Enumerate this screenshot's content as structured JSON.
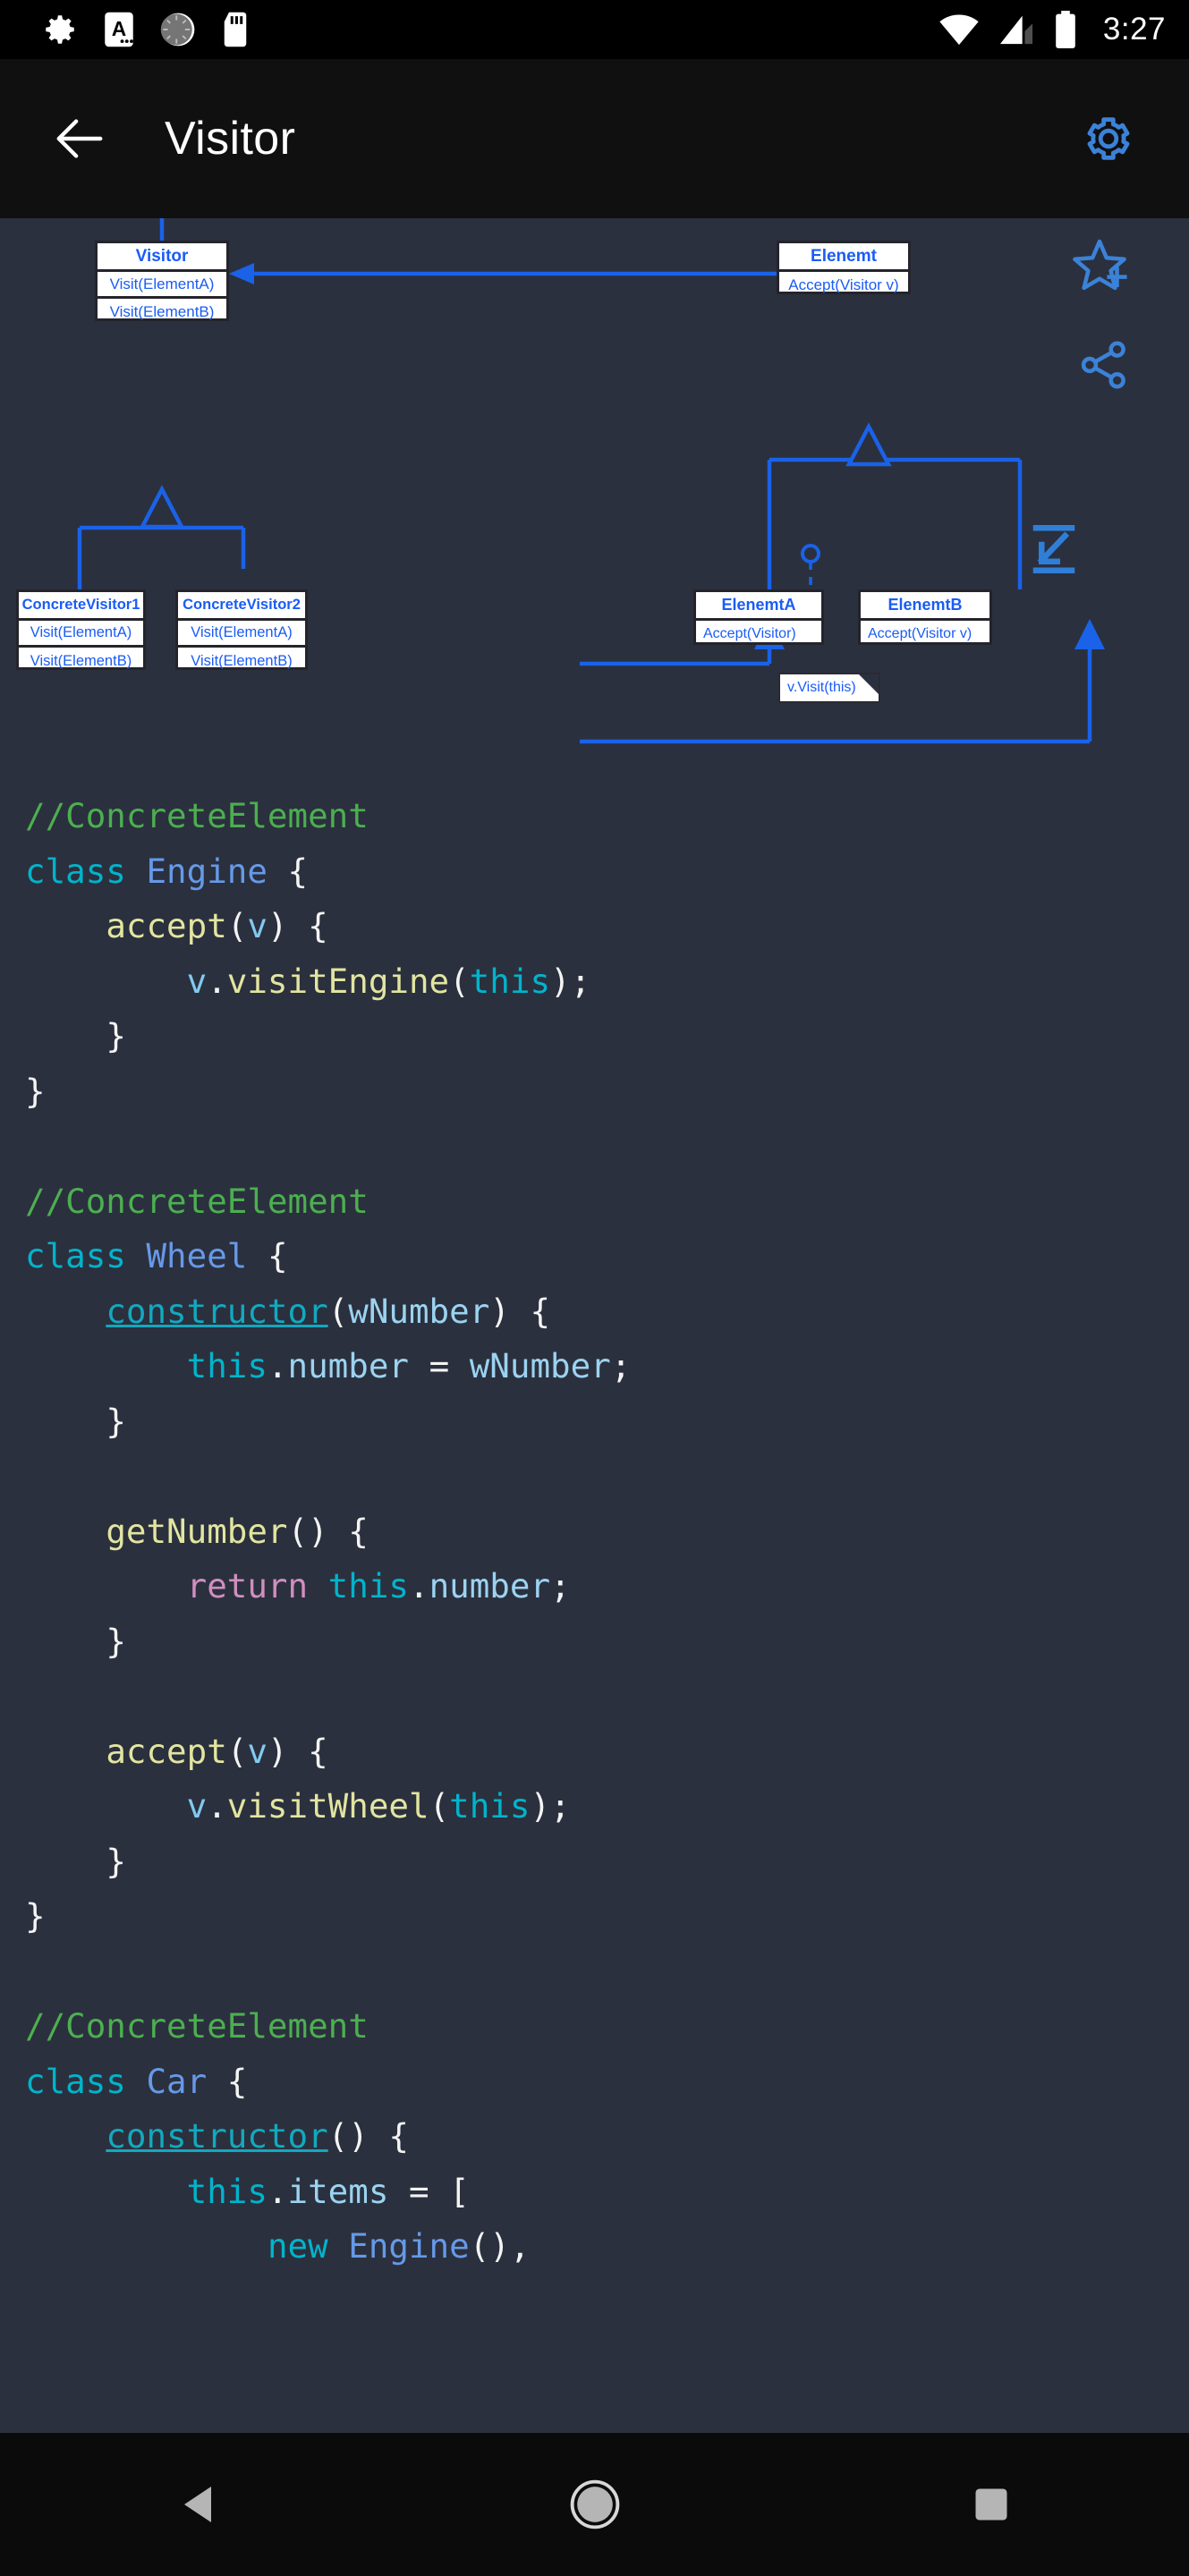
{
  "status_bar": {
    "icons": [
      "gear-icon",
      "app-notification-icon",
      "rotating-spinner-icon",
      "sd-card-icon"
    ],
    "wifi_icon": "wifi-icon",
    "signal_icon": "cellular-signal-icon",
    "battery_icon": "battery-full-icon",
    "time": "3:27"
  },
  "app_bar": {
    "back_icon": "back-arrow-icon",
    "title": "Visitor",
    "settings_icon": "gear-icon"
  },
  "diagram": {
    "accent_color": "#1a5cf5",
    "background": "#2b303e",
    "classes": [
      {
        "id": "visitor",
        "name": "Visitor",
        "methods": [
          "Visit(ElementA)",
          "Visit(ElementB)"
        ]
      },
      {
        "id": "element",
        "name": "Elenemt",
        "methods": [
          "Accept(Visitor v)"
        ]
      },
      {
        "id": "cvisitor1",
        "name": "ConcreteVisitor1",
        "methods": [
          "Visit(ElementA)",
          "Visit(ElementB)"
        ]
      },
      {
        "id": "cvisitor2",
        "name": "ConcreteVisitor2",
        "methods": [
          "Visit(ElementA)",
          "Visit(ElementB)"
        ]
      },
      {
        "id": "elementA",
        "name": "ElenemtA",
        "methods": [
          "Accept(Visitor)"
        ]
      },
      {
        "id": "elementB",
        "name": "ElenemtB",
        "methods": [
          "Accept(Visitor v)"
        ]
      }
    ],
    "note": "v.Visit(this)",
    "favorite_icon": "star-plus-icon",
    "share_icon": "share-icon",
    "zoom_icon": "zoom-out-icon"
  },
  "code": {
    "language": "javascript",
    "lines": [
      "//ConcreteElement",
      "class Engine {",
      "    accept(v) {",
      "        v.visitEngine(this);",
      "    }",
      "}",
      "",
      "//ConcreteElement",
      "class Wheel {",
      "    constructor(wNumber) {",
      "        this.number = wNumber;",
      "    }",
      "",
      "    getNumber() {",
      "        return this.number;",
      "    }",
      "",
      "    accept(v) {",
      "        v.visitWheel(this);",
      "    }",
      "}",
      "",
      "//ConcreteElement",
      "class Car {",
      "    constructor() {",
      "        this.items = [",
      "            new Engine(),"
    ],
    "colors": {
      "comment": "#4caf50",
      "keyword": "#00b4cc",
      "class_name": "#6699e8",
      "function": "#e2e5a0",
      "parameter": "#82c9f0",
      "this": "#00b4cc",
      "property": "#9bd3f0",
      "return": "#d08ec0",
      "punctuation": "#f4f4f4",
      "constructor": "#12a9bf"
    }
  },
  "nav_bar": {
    "back_icon": "nav-back-triangle-icon",
    "home_icon": "nav-home-circle-icon",
    "recents_icon": "nav-recents-square-icon"
  }
}
